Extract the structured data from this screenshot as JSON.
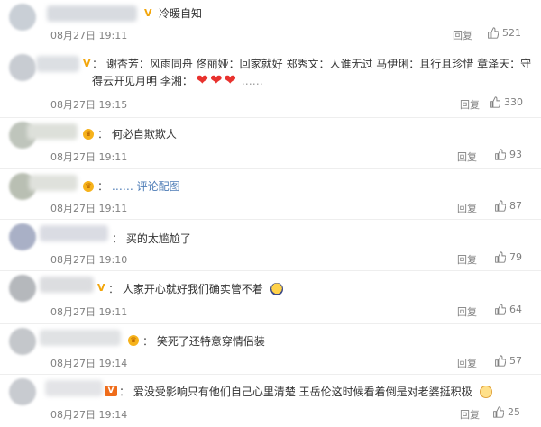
{
  "comments": [
    {
      "content": "冷暖自知",
      "time": "08月27日 19:11",
      "reply_label": "回复",
      "likes": "521"
    },
    {
      "sep": "：",
      "content": "谢杏芳：风雨同舟 佟丽娅：回家就好 郑秀文：人谁无过 马伊琍：且行且珍惜 章泽天：守得云开见月明 李湘：",
      "hearts": "❤❤❤",
      "ellipsis": "……",
      "time": "08月27日 19:15",
      "reply_label": "回复",
      "likes": "330"
    },
    {
      "sep": "：",
      "content": "何必自欺欺人",
      "time": "08月27日 19:11",
      "reply_label": "回复",
      "likes": "93"
    },
    {
      "sep": "：",
      "content": "…… 评论配图",
      "time": "08月27日 19:11",
      "reply_label": "回复",
      "likes": "87"
    },
    {
      "sep": "：",
      "content": "买的太尴尬了",
      "time": "08月27日 19:10",
      "reply_label": "回复",
      "likes": "79"
    },
    {
      "sep": "：",
      "content": "人家开心就好我们确实管不着",
      "time": "08月27日 19:11",
      "reply_label": "回复",
      "likes": "64"
    },
    {
      "sep": "：",
      "content": "笑死了还特意穿情侣装",
      "time": "08月27日 19:14",
      "reply_label": "回复",
      "likes": "57"
    },
    {
      "sep": "：",
      "content": "爱没受影响只有他们自己心里清楚 王岳伦这时候看着倒是对老婆挺积极",
      "time": "08月27日 19:14",
      "reply_label": "回复",
      "likes": "25"
    }
  ]
}
